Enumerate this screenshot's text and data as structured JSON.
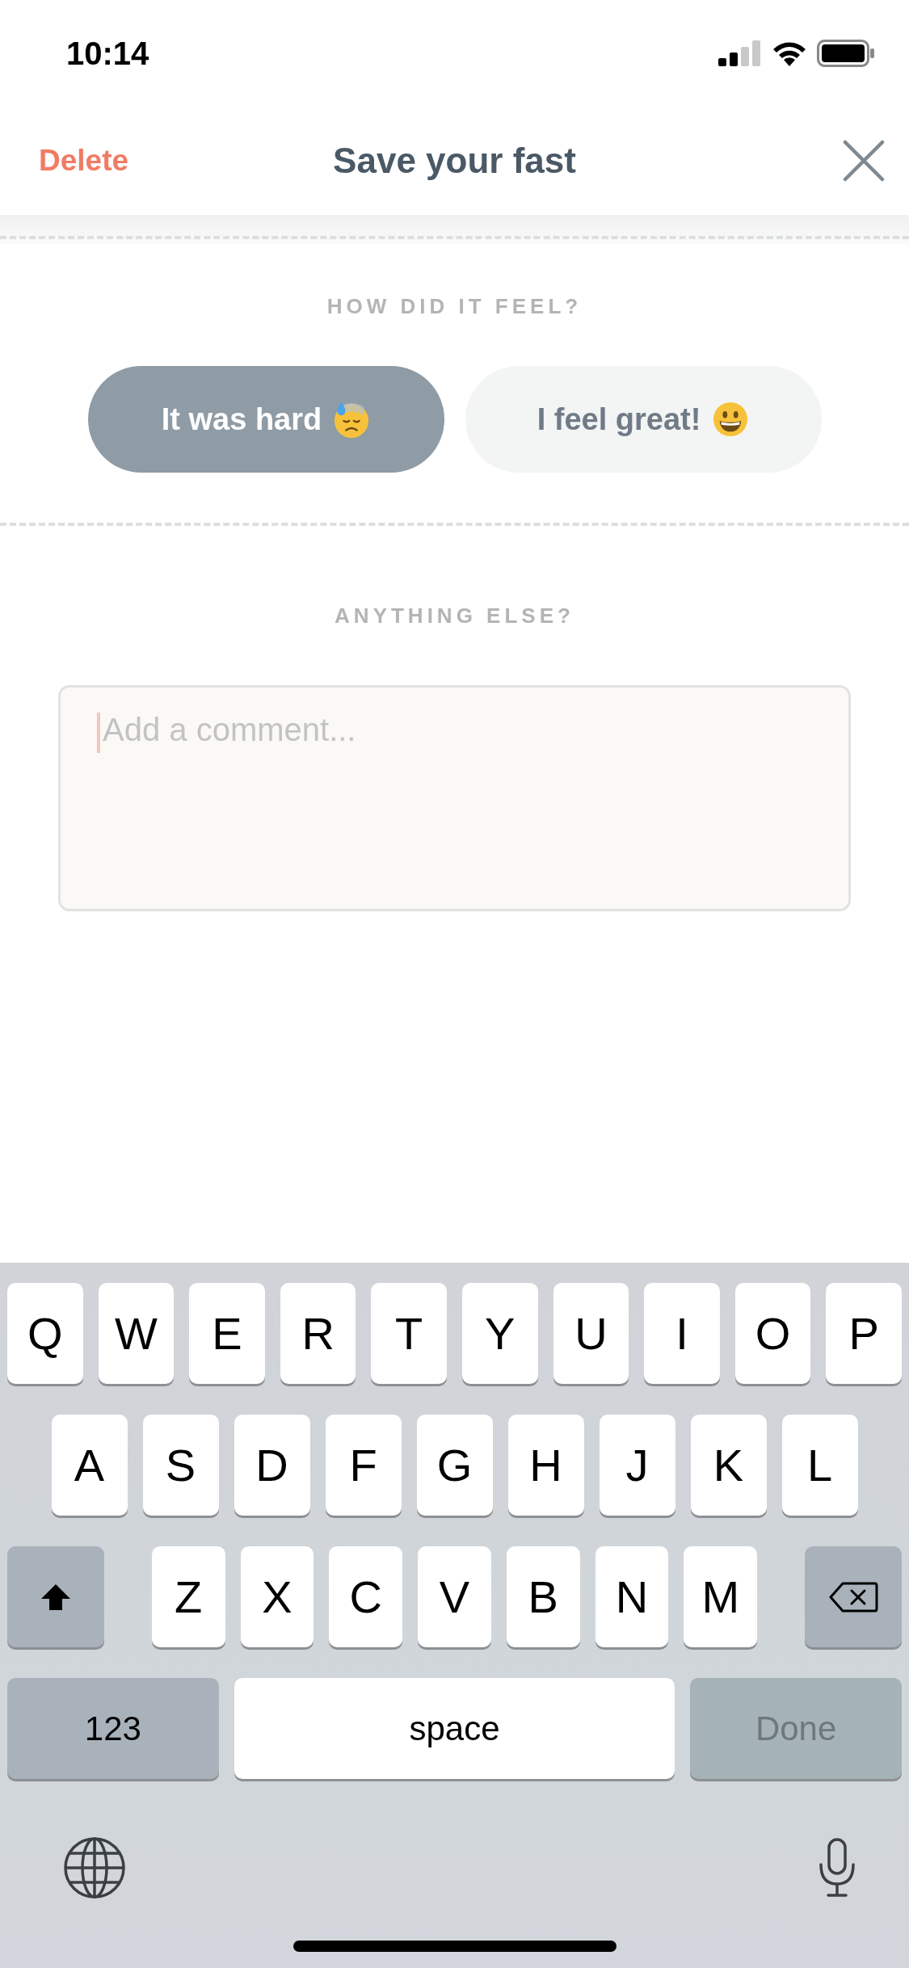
{
  "status_bar": {
    "time": "10:14"
  },
  "header": {
    "delete": "Delete",
    "title": "Save your fast"
  },
  "feel": {
    "label": "HOW DID IT FEEL?",
    "options": [
      {
        "label": "It was hard",
        "kind": "sweat",
        "selected": true
      },
      {
        "label": "I feel great!",
        "kind": "grin",
        "selected": false
      }
    ]
  },
  "comment": {
    "label": "ANYTHING ELSE?",
    "placeholder": "Add a comment..."
  },
  "keyboard": {
    "top_row": [
      {
        "kind": "letter",
        "label": "Q"
      },
      {
        "kind": "letter",
        "label": "W"
      },
      {
        "kind": "letter",
        "label": "E"
      },
      {
        "kind": "letter",
        "label": "R"
      },
      {
        "kind": "letter",
        "label": "T"
      },
      {
        "kind": "letter",
        "label": "Y"
      },
      {
        "kind": "letter",
        "label": "U"
      },
      {
        "kind": "letter",
        "label": "I"
      },
      {
        "kind": "letter",
        "label": "O"
      },
      {
        "kind": "letter",
        "label": "P"
      }
    ],
    "middle_row": [
      {
        "kind": "letter",
        "label": "A"
      },
      {
        "kind": "letter",
        "label": "S"
      },
      {
        "kind": "letter",
        "label": "D"
      },
      {
        "kind": "letter",
        "label": "F"
      },
      {
        "kind": "letter",
        "label": "G"
      },
      {
        "kind": "letter",
        "label": "H"
      },
      {
        "kind": "letter",
        "label": "J"
      },
      {
        "kind": "letter",
        "label": "K"
      },
      {
        "kind": "letter",
        "label": "L"
      }
    ],
    "lower_row": [
      {
        "kind": "shift"
      },
      {
        "kind": "letter",
        "label": "Z"
      },
      {
        "kind": "letter",
        "label": "X"
      },
      {
        "kind": "letter",
        "label": "C"
      },
      {
        "kind": "letter",
        "label": "V"
      },
      {
        "kind": "letter",
        "label": "B"
      },
      {
        "kind": "letter",
        "label": "N"
      },
      {
        "kind": "letter",
        "label": "M"
      },
      {
        "kind": "backspace"
      }
    ],
    "bottom_row": {
      "numbers": "123",
      "space": "space",
      "done": {
        "label": "Done",
        "disabled": true
      }
    }
  }
}
